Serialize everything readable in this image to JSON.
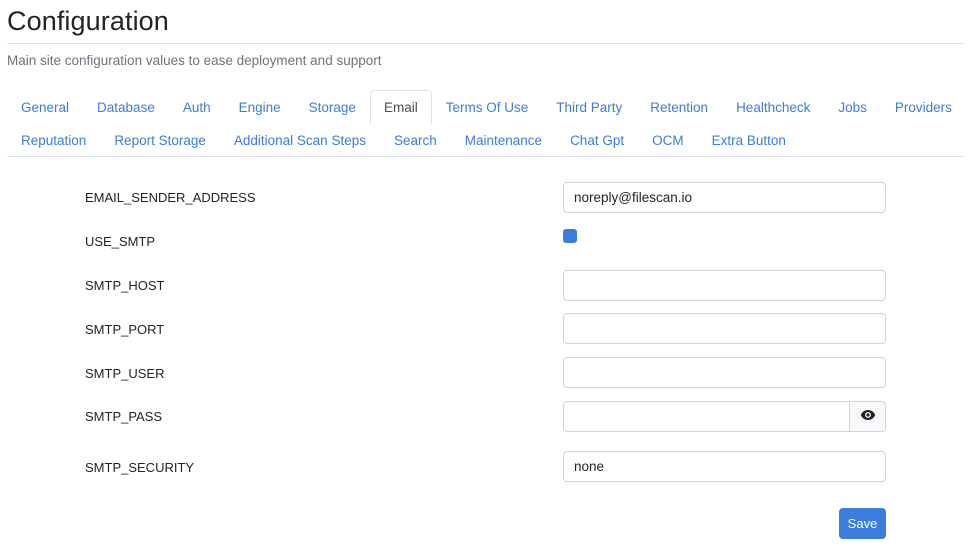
{
  "header": {
    "title": "Configuration",
    "subtitle": "Main site configuration values to ease deployment and support"
  },
  "tabs": {
    "row1": [
      "General",
      "Database",
      "Auth",
      "Engine",
      "Storage",
      "Email",
      "Terms Of Use",
      "Third Party",
      "Retention",
      "Healthcheck",
      "Jobs",
      "Providers"
    ],
    "row2": [
      "Reputation",
      "Report Storage",
      "Additional Scan Steps",
      "Search",
      "Maintenance",
      "Chat Gpt",
      "OCM",
      "Extra Button"
    ],
    "active": "Email"
  },
  "form": {
    "email_sender_address": {
      "label": "EMAIL_SENDER_ADDRESS",
      "value": "noreply@filescan.io"
    },
    "use_smtp": {
      "label": "USE_SMTP",
      "checked": true
    },
    "smtp_host": {
      "label": "SMTP_HOST",
      "value": ""
    },
    "smtp_port": {
      "label": "SMTP_PORT",
      "value": ""
    },
    "smtp_user": {
      "label": "SMTP_USER",
      "value": ""
    },
    "smtp_pass": {
      "label": "SMTP_PASS",
      "value": "",
      "toggle_icon": "eye-icon"
    },
    "smtp_security": {
      "label": "SMTP_SECURITY",
      "value": "none"
    }
  },
  "actions": {
    "save_label": "Save"
  },
  "colors": {
    "accent": "#3b7ddd",
    "border": "#ced4da",
    "text": "#212529",
    "muted": "#6c757d"
  }
}
